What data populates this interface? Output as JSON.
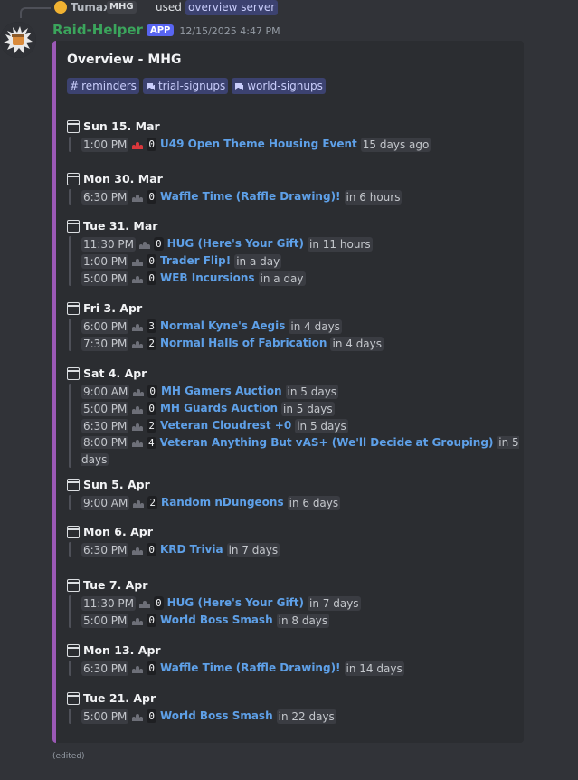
{
  "reply": {
    "user": "Tumax",
    "tag": "MHG",
    "used": "used",
    "command": "overview server"
  },
  "author": {
    "name": "Raid-Helper",
    "badge": "APP",
    "timestamp": "12/15/2025 4:47 PM"
  },
  "embed": {
    "title": "Overview - MHG",
    "accent": "#9b59b6",
    "channels": [
      {
        "icon": "hash-icon",
        "label": "reminders"
      },
      {
        "icon": "forum-icon",
        "label": "trial-signups"
      },
      {
        "icon": "forum-icon",
        "label": "world-signups"
      }
    ],
    "days": [
      {
        "label": "Sun 15. Mar",
        "events": [
          {
            "time": "1:00 PM",
            "icon": "red",
            "count": "0",
            "name": "U49 Open Theme Housing Event",
            "rel": "15 days ago"
          }
        ]
      },
      {
        "label": "Mon 30. Mar",
        "events": [
          {
            "time": "6:30 PM",
            "icon": "gray",
            "count": "0",
            "name": "Waffle Time (Raffle Drawing)!",
            "rel": "in 6 hours"
          }
        ]
      },
      {
        "label": "Tue 31. Mar",
        "events": [
          {
            "time": "11:30 PM",
            "icon": "gray",
            "count": "0",
            "name": "HUG (Here's Your Gift)",
            "rel": "in 11 hours"
          },
          {
            "time": "1:00 PM",
            "icon": "gray",
            "count": "0",
            "name": "Trader Flip!",
            "rel": "in a day"
          },
          {
            "time": "5:00 PM",
            "icon": "gray",
            "count": "0",
            "name": "WEB Incursions",
            "rel": "in a day"
          }
        ]
      },
      {
        "label": "Fri 3. Apr",
        "events": [
          {
            "time": "6:00 PM",
            "icon": "gray",
            "count": "3",
            "name": "Normal Kyne's Aegis",
            "rel": "in 4 days"
          },
          {
            "time": "7:30 PM",
            "icon": "gray",
            "count": "2",
            "name": "Normal Halls of Fabrication",
            "rel": "in 4 days"
          }
        ]
      },
      {
        "label": "Sat 4. Apr",
        "events": [
          {
            "time": "9:00 AM",
            "icon": "gray",
            "count": "0",
            "name": "MH Gamers Auction",
            "rel": "in 5 days"
          },
          {
            "time": "5:00 PM",
            "icon": "gray",
            "count": "0",
            "name": "MH Guards Auction",
            "rel": "in 5 days"
          },
          {
            "time": "6:30 PM",
            "icon": "gray",
            "count": "2",
            "name": "Veteran Cloudrest +0",
            "rel": "in 5 days"
          },
          {
            "time": "8:00 PM",
            "icon": "gray",
            "count": "4",
            "name": "Veteran Anything But vAS+ (We'll Decide at Grouping)",
            "rel": "in 5 days"
          }
        ]
      },
      {
        "label": "Sun 5. Apr",
        "events": [
          {
            "time": "9:00 AM",
            "icon": "gray",
            "count": "2",
            "name": "Random nDungeons",
            "rel": "in 6 days"
          }
        ]
      },
      {
        "label": "Mon 6. Apr",
        "events": [
          {
            "time": "6:30 PM",
            "icon": "gray",
            "count": "0",
            "name": "KRD Trivia",
            "rel": "in 7 days"
          }
        ]
      },
      {
        "label": "Tue 7. Apr",
        "events": [
          {
            "time": "11:30 PM",
            "icon": "gray",
            "count": "0",
            "name": "HUG (Here's Your Gift)",
            "rel": "in 7 days"
          },
          {
            "time": "5:00 PM",
            "icon": "gray",
            "count": "0",
            "name": "World Boss Smash",
            "rel": "in 8 days"
          }
        ]
      },
      {
        "label": "Mon 13. Apr",
        "events": [
          {
            "time": "6:30 PM",
            "icon": "gray",
            "count": "0",
            "name": "Waffle Time (Raffle Drawing)!",
            "rel": "in 14 days"
          }
        ]
      },
      {
        "label": "Tue 21. Apr",
        "events": [
          {
            "time": "5:00 PM",
            "icon": "gray",
            "count": "0",
            "name": "World Boss Smash",
            "rel": "in 22 days"
          }
        ]
      }
    ]
  },
  "edited": "(edited)"
}
